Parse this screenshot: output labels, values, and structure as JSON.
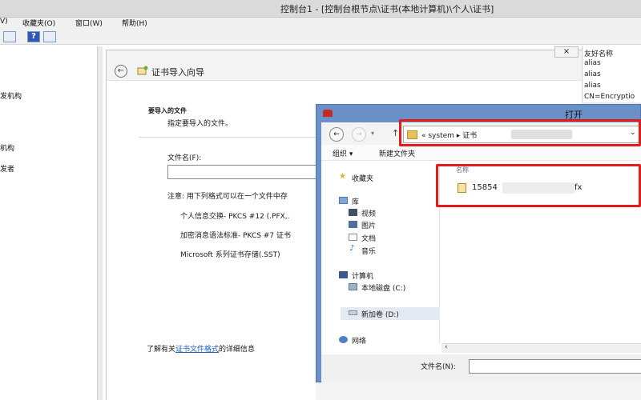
{
  "window": {
    "title": "控制台1 - [控制台根节点\\证书(本地计算机)\\个人\\证书]"
  },
  "menu": [
    "V)",
    "收藏夹(O)",
    "窗口(W)",
    "帮助(H)"
  ],
  "tree": {
    "items": [
      "发机构",
      "机构",
      "发者"
    ]
  },
  "wizard": {
    "title": "证书导入向导",
    "section_title": "要导入的文件",
    "section_desc": "指定要导入的文件。",
    "filename_label": "文件名(F):",
    "note": "注意: 用下列格式可以在一个文件中存",
    "formats": [
      "个人信息交换- PKCS #12 (.PFX,.",
      "加密消息语法标准- PKCS #7 证书",
      "Microsoft 系列证书存储(.SST)"
    ],
    "more_info_prefix": "了解有关",
    "more_info_link": "证书文件格式",
    "more_info_suffix": "的详细信息"
  },
  "right_panel": {
    "header": "友好名称",
    "items": [
      "alias",
      "alias",
      "alias",
      "CN=Encryptio"
    ]
  },
  "dialog": {
    "title": "打开",
    "breadcrumb": "«  system  ▸  证书",
    "toolbar": {
      "organize": "组织 ▾",
      "new_folder": "新建文件夹"
    },
    "nav": {
      "favorites": "收藏夹",
      "library": "库",
      "videos": "视频",
      "pictures": "图片",
      "documents": "文档",
      "music": "音乐",
      "computer": "计算机",
      "drive_c": "本地磁盘 (C:)",
      "drive_d": "新加卷 (D:)",
      "network": "网络"
    },
    "column_name": "名称",
    "file_prefix": "15854",
    "file_suffix": "fx",
    "filename_label": "文件名(N):"
  },
  "colors": {
    "highlight": "#e21b1b",
    "dialog_frame": "#6a90c8",
    "link": "#1a5fbf"
  }
}
